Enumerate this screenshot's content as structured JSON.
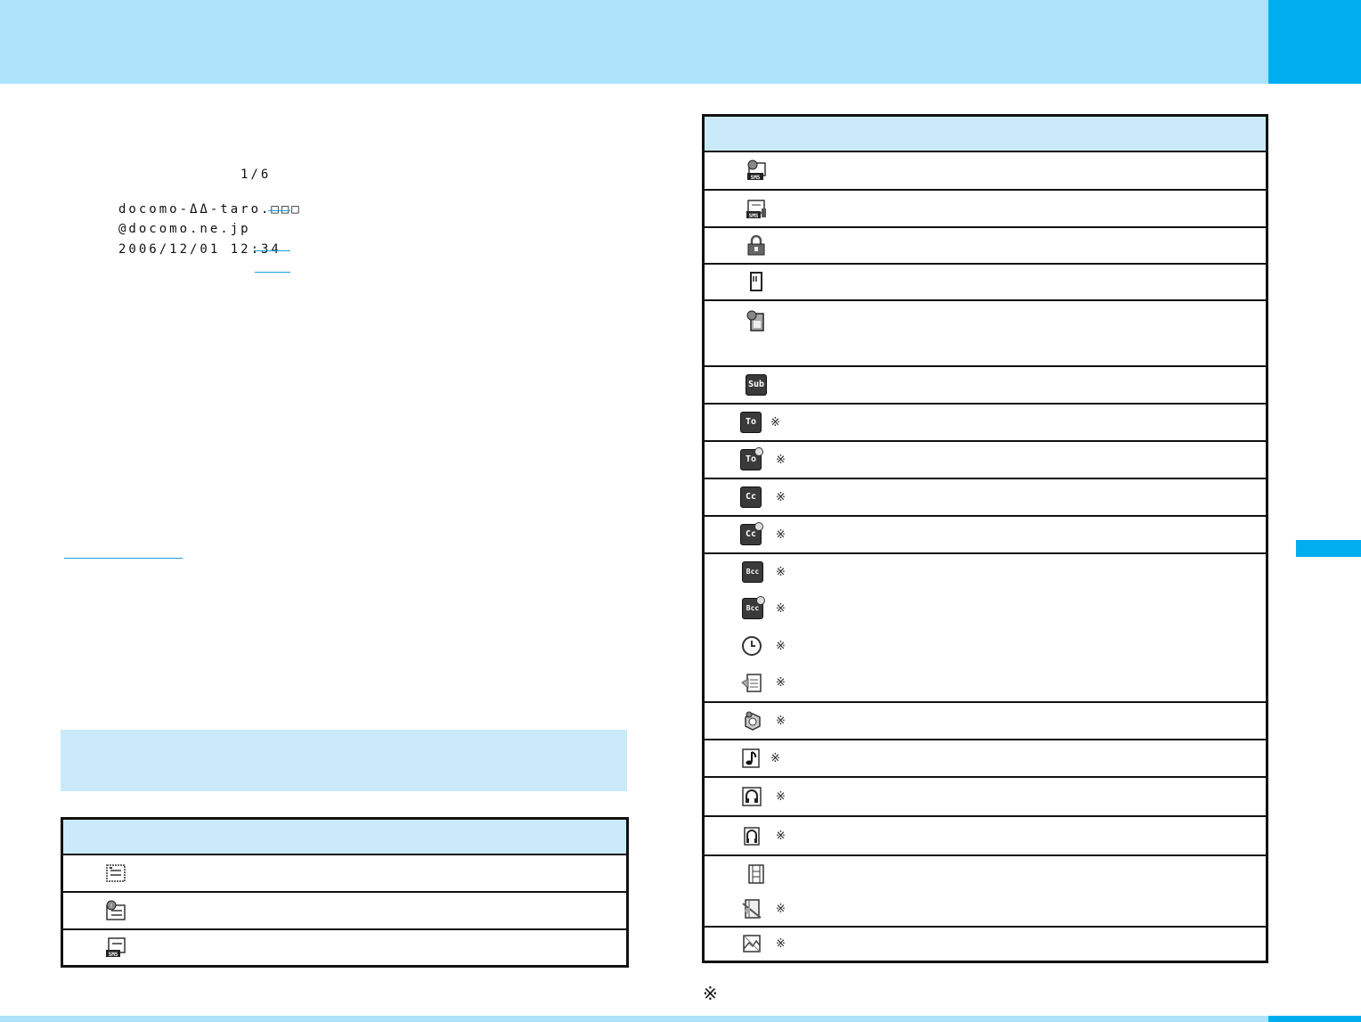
{
  "screen": {
    "page_indicator": "1/6",
    "lines": [
      "docomo-ΔΔ-taro.□□□",
      "@docomo.ne.jp",
      "2006/12/01 12:34"
    ]
  },
  "right_table": {
    "rows": [
      {
        "icon": "sms-unread-icon",
        "note": ""
      },
      {
        "icon": "sms-read-attached-icon",
        "note": ""
      },
      {
        "icon": "lock-icon",
        "note": ""
      },
      {
        "icon": "sd-card-icon",
        "note": ""
      },
      {
        "icon": "sd-unread-icon",
        "note": ""
      },
      {
        "icon": "subject-icon",
        "note": "",
        "label": "Sub"
      },
      {
        "icon": "to-icon",
        "note": "※",
        "label": "To"
      },
      {
        "icon": "to-multi-icon",
        "note": "※",
        "label": "To"
      },
      {
        "icon": "cc-icon",
        "note": "※",
        "label": "Cc"
      },
      {
        "icon": "cc-multi-icon",
        "note": "※",
        "label": "Cc"
      },
      {
        "icon": "bcc-icon",
        "note": "※",
        "label": "Bcc"
      },
      {
        "icon": "bcc-multi-icon",
        "note": "※",
        "label": "Bcc"
      },
      {
        "icon": "clock-icon",
        "note": "※"
      },
      {
        "icon": "melody-doc-icon",
        "note": "※"
      },
      {
        "icon": "toruca-icon",
        "note": "※"
      },
      {
        "icon": "music-note-icon",
        "note": "※"
      },
      {
        "icon": "headphones-icon",
        "note": "※"
      },
      {
        "icon": "headphones-alt-icon",
        "note": "※"
      },
      {
        "icon": "film-icon",
        "note": ""
      },
      {
        "icon": "film-broken-icon",
        "note": "※"
      },
      {
        "icon": "image-broken-icon",
        "note": "※"
      }
    ],
    "footnote": "※"
  },
  "left_table": {
    "rows": [
      {
        "icon": "mail-read-icon"
      },
      {
        "icon": "mail-unread-icon"
      },
      {
        "icon": "sms-mail-icon"
      }
    ]
  }
}
